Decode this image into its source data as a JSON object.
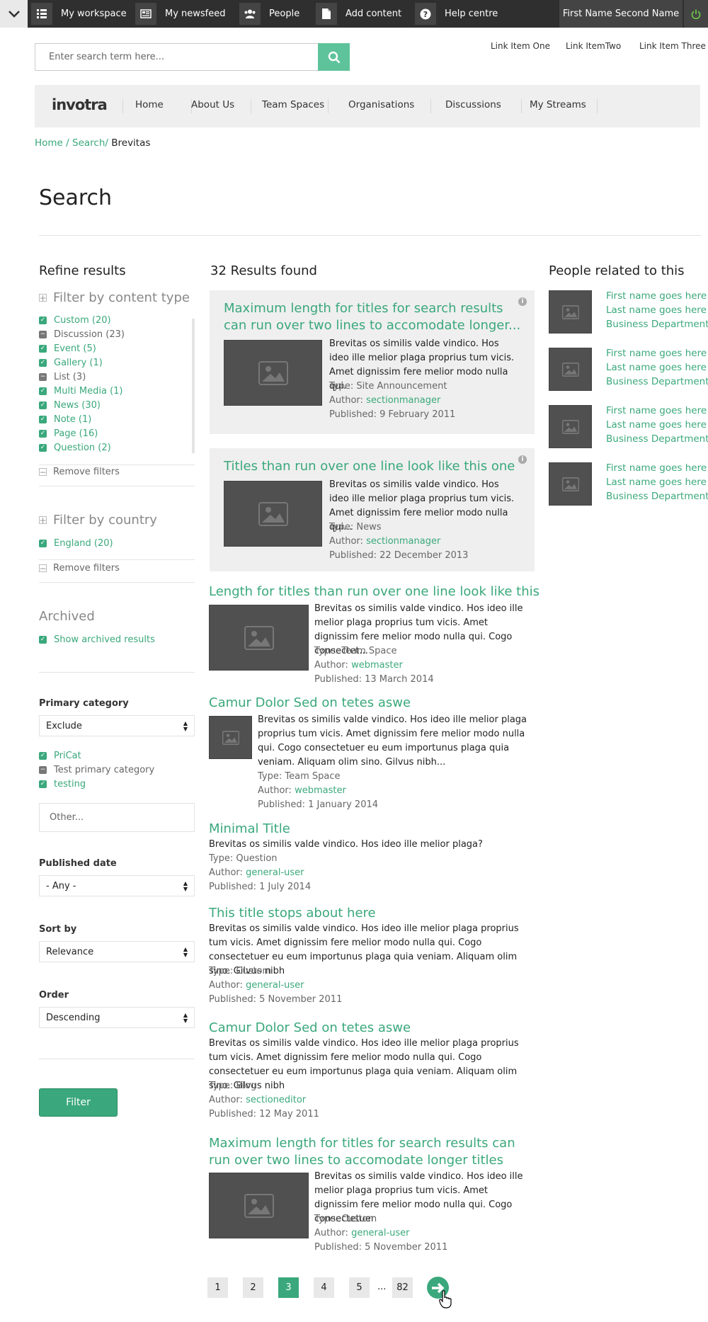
{
  "topbar": {
    "items": [
      {
        "label": "My workspace",
        "icon": "list-icon"
      },
      {
        "label": "My newsfeed",
        "icon": "newspaper-icon"
      },
      {
        "label": "People",
        "icon": "people-icon"
      },
      {
        "label": "Add content",
        "icon": "document-icon"
      },
      {
        "label": "Help centre",
        "icon": "help-icon"
      }
    ],
    "user": "First Name Second Name",
    "power_icon": "power-icon",
    "menu_icon": "chevron-down-icon"
  },
  "search": {
    "placeholder": "Enter search term here...",
    "icon": "search-icon"
  },
  "toplinks": [
    "Link Item One",
    "Link ItemTwo",
    "Link Item Three"
  ],
  "nav": {
    "logo": "invotra",
    "items": [
      "Home",
      "About Us",
      "Team Spaces",
      "Organisations",
      "Discussions",
      "My Streams"
    ]
  },
  "breadcrumb": {
    "home": "Home /",
    "search": "Search/",
    "current": "Brevitas"
  },
  "page_title": "Search",
  "refine": {
    "title": "Refine results",
    "content_type": {
      "heading": "Filter by content type",
      "items": [
        {
          "label": "Custom (20)",
          "state": "on"
        },
        {
          "label": "Discussion (23)",
          "state": "mid"
        },
        {
          "label": "Event (5)",
          "state": "on"
        },
        {
          "label": "Gallery (1)",
          "state": "on"
        },
        {
          "label": "List (3)",
          "state": "mid"
        },
        {
          "label": "Multi Media (1)",
          "state": "on"
        },
        {
          "label": "News (30)",
          "state": "on"
        },
        {
          "label": "Note (1)",
          "state": "on"
        },
        {
          "label": "Page (16)",
          "state": "on"
        },
        {
          "label": "Question (2)",
          "state": "on"
        }
      ],
      "remove": "Remove filters"
    },
    "country": {
      "heading": "Filter by country",
      "items": [
        {
          "label": "England (20)",
          "state": "on"
        }
      ],
      "remove": "Remove filters"
    },
    "archived": {
      "heading": "Archived",
      "label": "Show archived results"
    },
    "primary_category": {
      "label": "Primary category",
      "selected": "Exclude",
      "items": [
        {
          "label": "PriCat",
          "state": "on"
        },
        {
          "label": "Test primary category",
          "state": "mid"
        },
        {
          "label": "testing",
          "state": "on"
        }
      ],
      "other_placeholder": "Other..."
    },
    "published_date": {
      "label": "Published date",
      "selected": "- Any -"
    },
    "sort_by": {
      "label": "Sort by",
      "selected": "Relevance"
    },
    "order": {
      "label": "Order",
      "selected": "Descending"
    },
    "filter_button": "Filter"
  },
  "results": {
    "heading": "32 Results found",
    "items": [
      {
        "title": "Maximum length for titles for search results can run over two lines to accomodate longer...",
        "body": "Brevitas os similis valde vindico. Hos ideo ille melior plaga proprius tum vicis. Amet dignissim fere melior modo nulla qui.",
        "type": "Type: Site Announcement",
        "author_label": "Author:",
        "author": "sectionmanager",
        "published": "Published: 9 February 2011"
      },
      {
        "title": "Titles than run over one line look like this one",
        "body": "Brevitas os similis valde vindico. Hos ideo ille melior plaga proprius tum vicis. Amet dignissim fere melior modo nulla qui...",
        "type": "Type: News",
        "author_label": "Author:",
        "author": "sectionmanager",
        "published": "Published: 22 December 2013"
      },
      {
        "title": "Length for titles than run over one line look like this",
        "body": "Brevitas os similis valde vindico. Hos ideo ille melior plaga proprius tum vicis. Amet dignissim fere melior modo nulla qui. Cogo consectet...",
        "type": "Type: Team Space",
        "author_label": "Author:",
        "author": "webmaster",
        "published": "Published: 13 March 2014"
      },
      {
        "title": "Camur Dolor Sed on tetes aswe",
        "body": "Brevitas os similis valde vindico. Hos ideo ille melior plaga proprius tum vicis. Amet dignissim fere melior modo nulla qui. Cogo consectetuer eu eum importunus plaga quia veniam. Aliquam olim sino. Gilvus nibh...",
        "type": "Type: Team Space",
        "author_label": "Author:",
        "author": "webmaster",
        "published": "Published: 1 January 2014"
      },
      {
        "title": "Minimal Title",
        "body": "Brevitas os similis valde vindico. Hos ideo ille melior plaga?",
        "type": "Type: Question",
        "author_label": "Author:",
        "author": "general-user",
        "published": "Published: 1 July 2014"
      },
      {
        "title": "This title stops about here",
        "body": "Brevitas os similis valde vindico. Hos ideo ille melior plaga proprius tum vicis. Amet dignissim fere melior modo nulla qui. Cogo consectetuer eu eum importunus plaga quia veniam. Aliquam olim sino. Gilvus nibh",
        "type": "Type: Custom",
        "author_label": "Author:",
        "author": "general-user",
        "published": "Published: 5 November 2011"
      },
      {
        "title": "Camur Dolor Sed on tetes aswe",
        "body": "Brevitas os similis valde vindico. Hos ideo ille melior plaga proprius tum vicis. Amet dignissim fere melior modo nulla qui. Cogo consectetuer eu eum importunus plaga quia veniam. Aliquam olim sino. Gilvus nibh",
        "type": "Type: Blog",
        "author_label": "Author:",
        "author": "sectioneditor",
        "published": "Published: 12 May 2011"
      },
      {
        "title": "Maximum length for titles for search results can run over two lines to accomodate longer titles",
        "body": "Brevitas os similis valde vindico. Hos ideo ille melior plaga proprius tum vicis. Amet dignissim fere melior modo nulla qui. Cogo consectetuer",
        "type": "Type: Custom",
        "author_label": "Author:",
        "author": "general-user",
        "published": "Published: 5 November 2011"
      }
    ]
  },
  "people": {
    "heading": "People related to this",
    "items": [
      {
        "first": "First name goes here",
        "last": "Last name goes here",
        "dept": "Business Department"
      },
      {
        "first": "First name goes here",
        "last": "Last name goes here",
        "dept": "Business Department"
      },
      {
        "first": "First name goes here",
        "last": "Last name goes here",
        "dept": "Business Department"
      },
      {
        "first": "First name goes here",
        "last": "Last name goes here",
        "dept": "Business Department"
      }
    ]
  },
  "pagination": {
    "pages": [
      "1",
      "2",
      "3",
      "4",
      "5"
    ],
    "current": "3",
    "ellipsis": "...",
    "last": "82",
    "next_icon": "arrow-right-icon"
  },
  "colors": {
    "accent": "#3aa87c",
    "topbar": "#2f2f2f"
  }
}
